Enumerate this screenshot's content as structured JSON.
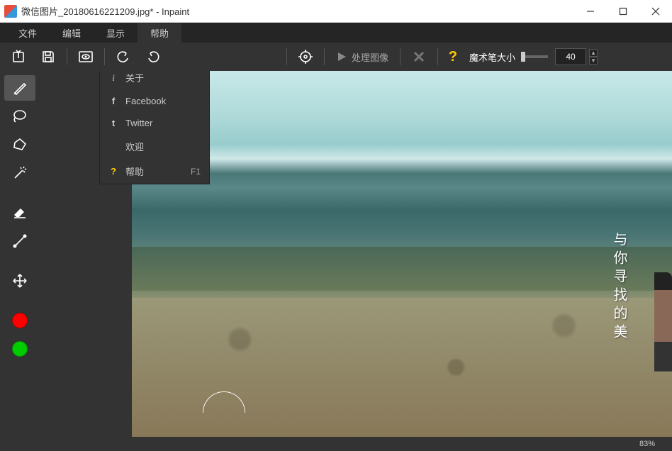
{
  "titlebar": {
    "title": "微信图片_20180616221209.jpg* - Inpaint"
  },
  "menubar": {
    "file": "文件",
    "edit": "编辑",
    "view": "显示",
    "help": "帮助"
  },
  "toolbar": {
    "process": "处理图像",
    "brush_label": "魔术笔大小",
    "brush_value": "40"
  },
  "dropdown": {
    "about": "关于",
    "facebook": "Facebook",
    "twitter": "Twitter",
    "welcome": "欢迎",
    "help": "帮助",
    "help_shortcut": "F1"
  },
  "canvas": {
    "vertical_text": "与你寻找的美"
  },
  "statusbar": {
    "zoom": "83%"
  }
}
